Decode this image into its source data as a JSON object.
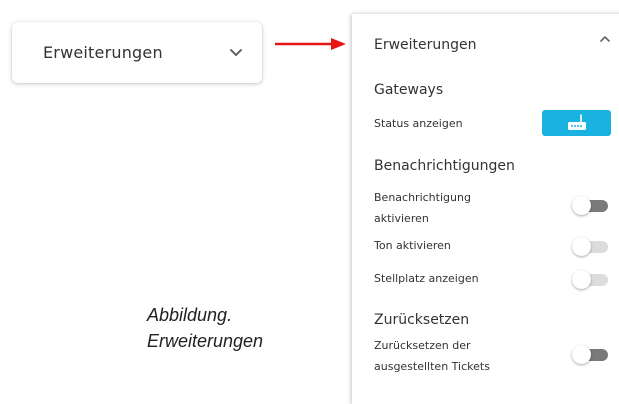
{
  "collapsed_dropdown": {
    "label": "Erweiterungen"
  },
  "panel": {
    "title": "Erweiterungen",
    "sections": {
      "gateways": {
        "title": "Gateways",
        "status_label": "Status anzeigen",
        "button_icon": "router-icon",
        "button_color": "#19b2e1"
      },
      "notifications": {
        "title": "Benachrichtigungen",
        "items": [
          {
            "label_line1": "Benachrichtigung",
            "label_line2": "aktivieren",
            "enabled": false,
            "style": "dark"
          },
          {
            "label": "Ton aktivieren",
            "enabled": false,
            "style": "light"
          },
          {
            "label": "Stellplatz anzeigen",
            "enabled": false,
            "style": "light"
          }
        ]
      },
      "reset": {
        "title": "Zurücksetzen",
        "item": {
          "label_line1": "Zurücksetzen der",
          "label_line2": "ausgestellten Tickets",
          "enabled": false,
          "style": "dark"
        }
      }
    }
  },
  "caption": {
    "line1": "Abbildung.",
    "line2": "Erweiterungen"
  },
  "colors": {
    "arrow": "#e81515",
    "accent": "#19b2e1",
    "toggle_dark": "#7a7a7a",
    "toggle_light": "#dcdcdc"
  }
}
